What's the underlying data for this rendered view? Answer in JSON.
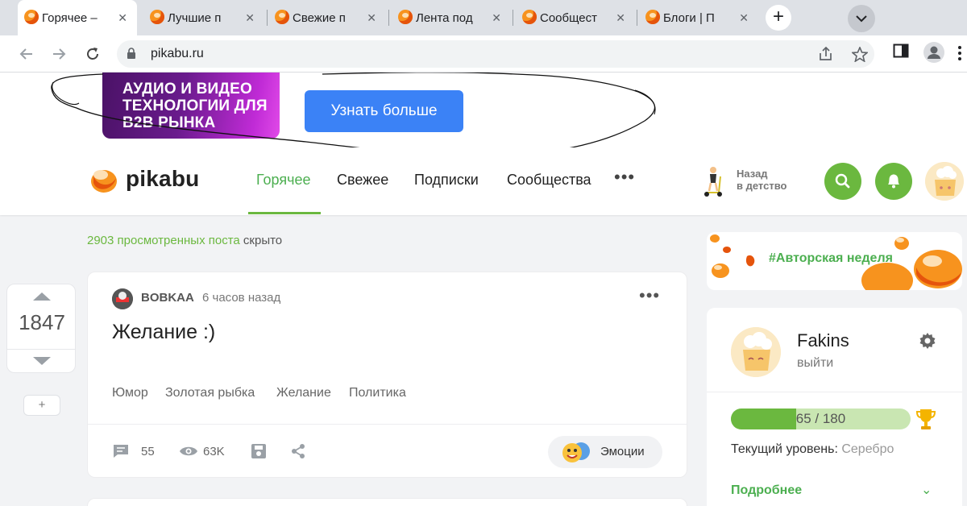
{
  "browser": {
    "tabs": [
      {
        "title": "Горячее –",
        "active": true
      },
      {
        "title": "Лучшие п"
      },
      {
        "title": "Свежие п"
      },
      {
        "title": "Лента под"
      },
      {
        "title": "Сообщест"
      },
      {
        "title": "Блоги | П"
      }
    ],
    "close_glyph": "✕",
    "new_tab_glyph": "+",
    "url": "pikabu.ru"
  },
  "promo": {
    "image_text": "АУДИО И ВИДЕО ТЕХНОЛОГИИ ДЛЯ B2B РЫНКА",
    "button": "Узнать больше"
  },
  "header": {
    "logo": "pikabu",
    "nav": [
      "Горячее",
      "Свежее",
      "Подписки",
      "Сообщества"
    ],
    "more": "•••",
    "childhood_line1": "Назад",
    "childhood_line2": "в детство"
  },
  "feed": {
    "hidden_count_link": "2903 просмотренных поста",
    "hidden_suffix": " скрыто",
    "rating": "1847",
    "add_label": "+"
  },
  "story": {
    "author": "BOBKAA",
    "time": "6 часов назад",
    "menu": "•••",
    "title": "Желание :)",
    "tags": [
      "Юмор",
      "Золотая рыбка",
      "Желание",
      "Политика"
    ],
    "comments": "55",
    "views": "63K",
    "emotions": "Эмоции"
  },
  "aside": {
    "banner": "#Авторская неделя",
    "profile": {
      "name": "Fakins",
      "logout": "выйти",
      "progress_text": "65 / 180",
      "progress_value": 65,
      "progress_max": 180,
      "level_label": "Текущий уровень: ",
      "level_value": "Серебро",
      "more": "Подробнее",
      "more_chevron": "⌄"
    }
  },
  "colors": {
    "accent_green": "#6bb83f",
    "promo_button": "#3b82f6",
    "promo_purple": "#6a1b8d"
  },
  "icons": [
    "search-icon",
    "bell-icon",
    "gear-icon",
    "trophy-icon",
    "comment-icon",
    "eye-icon",
    "save-icon",
    "share-icon",
    "lock-icon",
    "star-icon",
    "profile-icon"
  ]
}
